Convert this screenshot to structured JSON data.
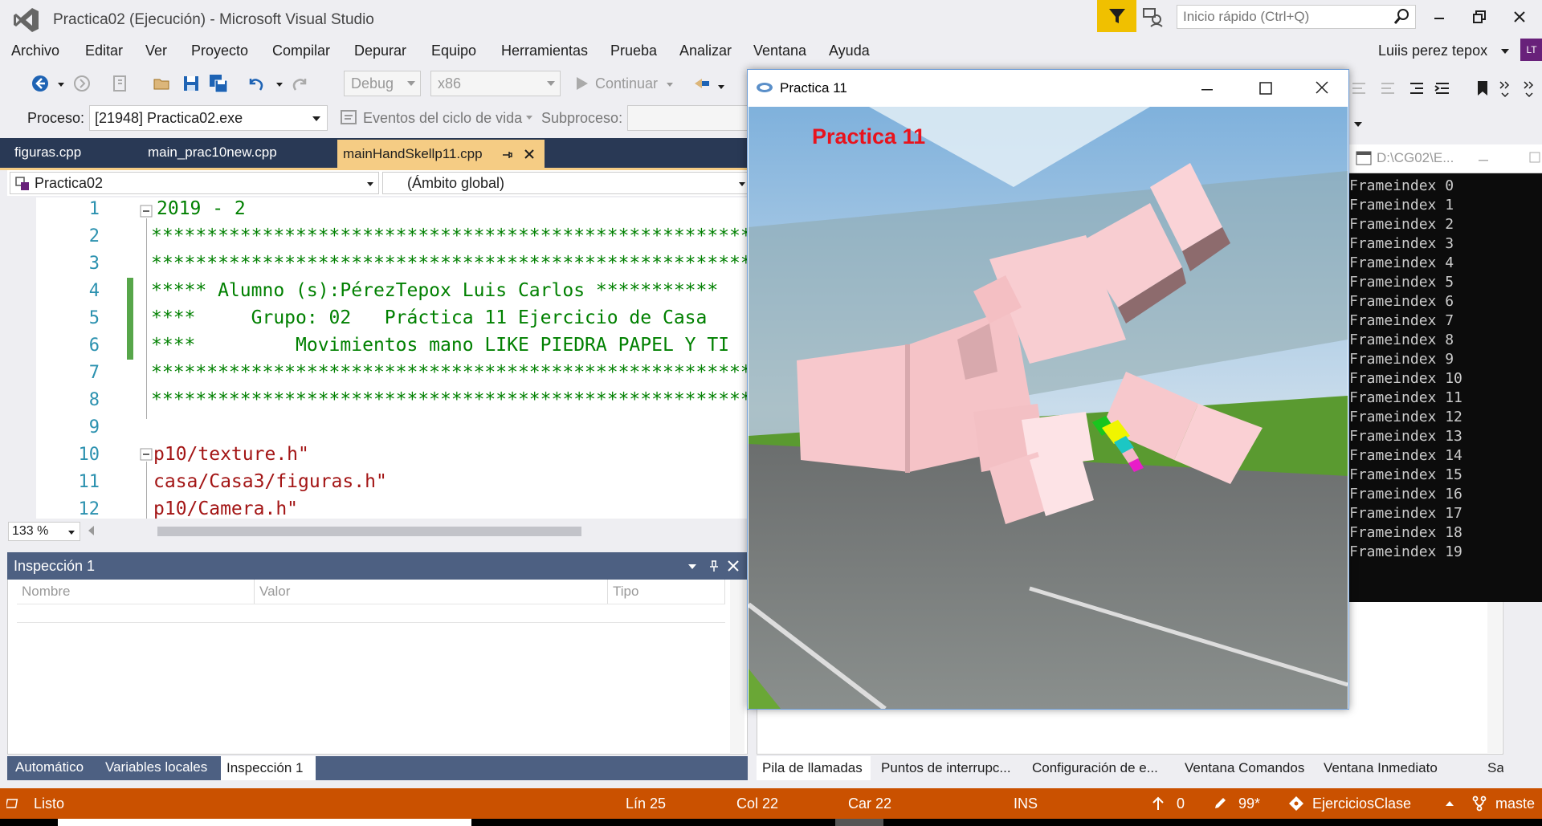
{
  "window": {
    "title": "Practica02 (Ejecución) - Microsoft Visual Studio",
    "quick_launch_placeholder": "Inicio rápido (Ctrl+Q)",
    "user_name": "Luiis perez tepox",
    "user_initials": "LT"
  },
  "menu": [
    "Archivo",
    "Editar",
    "Ver",
    "Proyecto",
    "Compilar",
    "Depurar",
    "Equipo",
    "Herramientas",
    "Prueba",
    "Analizar",
    "Ventana",
    "Ayuda"
  ],
  "toolbar": {
    "config": "Debug",
    "platform": "x86",
    "continue_label": "Continuar"
  },
  "debug_location": {
    "process_label": "Proceso:",
    "process_value": "[21948] Practica02.exe",
    "lifecycle_events_label": "Eventos del ciclo de vida",
    "thread_label": "Subproceso:"
  },
  "tabs": [
    {
      "label": "figuras.cpp"
    },
    {
      "label": "main_prac10new.cpp"
    },
    {
      "label": "mainHandSkellp11.cpp",
      "active": true
    }
  ],
  "navbar": {
    "project": "Practica02",
    "scope": "(Ámbito global)"
  },
  "editor": {
    "zoom": "133 %",
    "lines": [
      {
        "n": "1",
        "text": "2019 - 2",
        "kind": "cmt"
      },
      {
        "n": "2",
        "text": "******************************************************/",
        "kind": "cmt"
      },
      {
        "n": "3",
        "text": "******************************************************/",
        "kind": "cmt"
      },
      {
        "n": "4",
        "text": "***** Alumno (s):PérezTepox Luis Carlos ***********",
        "kind": "cmt"
      },
      {
        "n": "5",
        "text": "****     Grupo: 02   Práctica 11 Ejercicio de Casa",
        "kind": "cmt"
      },
      {
        "n": "6",
        "text": "****         Movimientos mano LIKE PIEDRA PAPEL Y TI",
        "kind": "cmt"
      },
      {
        "n": "7",
        "text": "******************************************************/",
        "kind": "cmt"
      },
      {
        "n": "8",
        "text": "******************************************************/",
        "kind": "cmt"
      },
      {
        "n": "9",
        "text": "",
        "kind": "cmt"
      },
      {
        "n": "10",
        "text": "p10/texture.h\"",
        "kind": "str"
      },
      {
        "n": "11",
        "text": "casa/Casa3/figuras.h\"",
        "kind": "str"
      },
      {
        "n": "12",
        "text": "p10/Camera.h\"",
        "kind": "str"
      }
    ]
  },
  "watch": {
    "title": "Inspección 1",
    "columns": [
      "Nombre",
      "Valor",
      "Tipo"
    ]
  },
  "left_bottom_tabs": [
    "Automático",
    "Variables locales",
    "Inspección 1"
  ],
  "right_bottom_tabs": [
    "Pila de llamadas",
    "Puntos de interrupc...",
    "Configuración de e...",
    "Ventana Comandos",
    "Ventana Inmediato",
    "Salida"
  ],
  "console": {
    "title": "D:\\CG02\\E...",
    "lines": [
      "Frameindex 0",
      "Frameindex 1",
      "Frameindex 2",
      "Frameindex 3",
      "Frameindex 4",
      "Frameindex 5",
      "Frameindex 6",
      "Frameindex 7",
      "Frameindex 8",
      "Frameindex 9",
      "Frameindex 10",
      "Frameindex 11",
      "Frameindex 12",
      "Frameindex 13",
      "Frameindex 14",
      "Frameindex 15",
      "Frameindex 16",
      "Frameindex 17",
      "Frameindex 18",
      "Frameindex 19"
    ]
  },
  "app_window": {
    "title": "Practica 11",
    "scene_text": "Practica 11"
  },
  "status": {
    "ready": "Listo",
    "line": "Lín 25",
    "col": "Col 22",
    "char": "Car 22",
    "mode": "INS",
    "push_count": "0",
    "edits": "99*",
    "repo": "EjerciciosClase",
    "branch": "master"
  },
  "colors": {
    "accent_statusbar": "#ca5100",
    "active_tab": "#f5cc84",
    "panel_header": "#4d6082",
    "filter_button": "#f0c000"
  }
}
